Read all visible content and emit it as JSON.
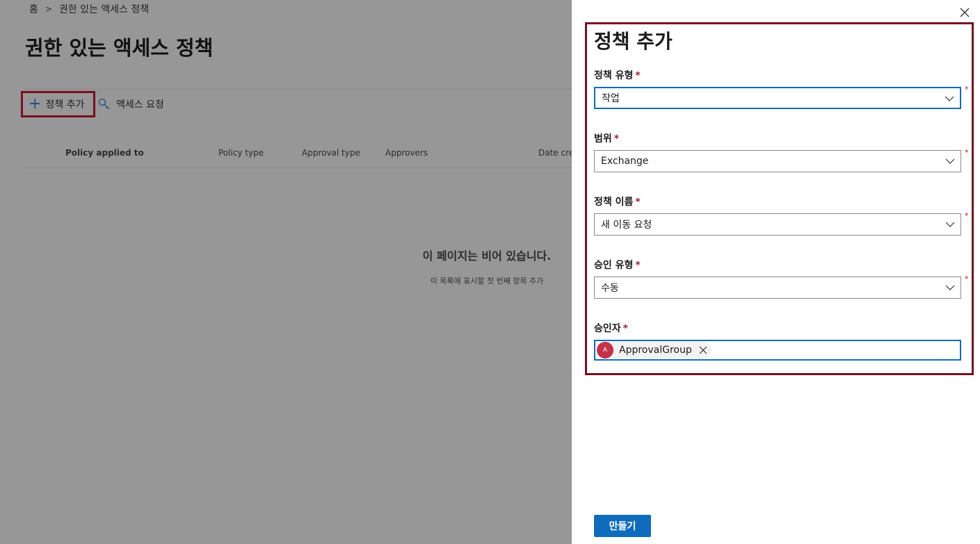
{
  "breadcrumb": {
    "home": "홈",
    "separator": ">",
    "current": "권한 있는 액세스 정책"
  },
  "page": {
    "title": "권한 있는 액세스 정책"
  },
  "commands": {
    "add_policy": "정책 추가",
    "access_requests": "액세스 요청"
  },
  "table": {
    "columns": [
      "Policy applied to",
      "Policy type",
      "Approval type",
      "Approvers",
      "Date created"
    ],
    "empty_title": "이 페이지는 비어 있습니다.",
    "empty_subtitle": "이 목록에 표시할 첫 번째 항목 추가"
  },
  "panel": {
    "title": "정책 추가",
    "required_mark": "*",
    "fields": {
      "policy_type": {
        "label": "정책 유형",
        "value": "작업"
      },
      "scope": {
        "label": "범위",
        "value": "Exchange"
      },
      "policy_name": {
        "label": "정책 이름",
        "value": "새 이동 요청"
      },
      "approval_type": {
        "label": "승인 유형",
        "value": "수동"
      },
      "approvers": {
        "label": "승인자",
        "persona_initial": "A",
        "persona_name": "ApprovalGroup"
      }
    },
    "create_button": "만들기"
  },
  "colors": {
    "accent": "#0f6cbd",
    "highlight_border": "#7a0e1e",
    "required": "#a4262c",
    "avatar": "#c4314b"
  }
}
